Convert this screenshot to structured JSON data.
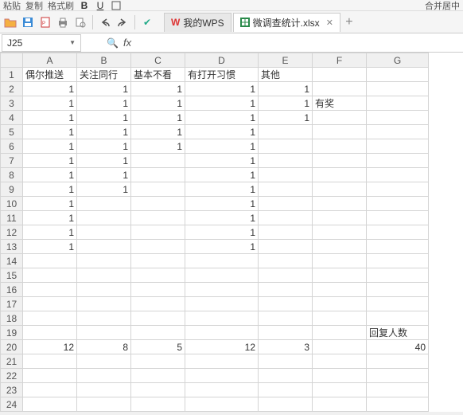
{
  "toolbar": {
    "paste_label": "粘贴",
    "copy_label": "复制",
    "format_painter_label": "格式刷",
    "merge_center_label": "合并居中"
  },
  "tabs": {
    "tab1": {
      "label": "我的WPS"
    },
    "tab2": {
      "label": "微调查统计.xlsx"
    },
    "add_label": "+"
  },
  "formula_bar": {
    "name_box_value": "J25",
    "fx_label": "fx",
    "formula_value": ""
  },
  "columns": [
    "A",
    "B",
    "C",
    "D",
    "E",
    "F",
    "G"
  ],
  "rows": [
    "1",
    "2",
    "3",
    "4",
    "5",
    "6",
    "7",
    "8",
    "9",
    "10",
    "11",
    "12",
    "13",
    "14",
    "15",
    "16",
    "17",
    "18",
    "19",
    "20",
    "21",
    "22",
    "23",
    "24"
  ],
  "headers_row": {
    "A": "偶尔推送",
    "B": "关注同行",
    "C": "基本不看",
    "D": "有打开习惯",
    "E": "其他",
    "F": "",
    "G": ""
  },
  "cells": {
    "r2": {
      "A": "1",
      "B": "1",
      "C": "1",
      "D": "1",
      "E": "1",
      "F": "",
      "G": ""
    },
    "r3": {
      "A": "1",
      "B": "1",
      "C": "1",
      "D": "1",
      "E": "1",
      "F": "有奖",
      "G": ""
    },
    "r4": {
      "A": "1",
      "B": "1",
      "C": "1",
      "D": "1",
      "E": "1",
      "F": "",
      "G": ""
    },
    "r5": {
      "A": "1",
      "B": "1",
      "C": "1",
      "D": "1",
      "E": "",
      "F": "",
      "G": ""
    },
    "r6": {
      "A": "1",
      "B": "1",
      "C": "1",
      "D": "1",
      "E": "",
      "F": "",
      "G": ""
    },
    "r7": {
      "A": "1",
      "B": "1",
      "C": "",
      "D": "1",
      "E": "",
      "F": "",
      "G": ""
    },
    "r8": {
      "A": "1",
      "B": "1",
      "C": "",
      "D": "1",
      "E": "",
      "F": "",
      "G": ""
    },
    "r9": {
      "A": "1",
      "B": "1",
      "C": "",
      "D": "1",
      "E": "",
      "F": "",
      "G": ""
    },
    "r10": {
      "A": "1",
      "B": "",
      "C": "",
      "D": "1",
      "E": "",
      "F": "",
      "G": ""
    },
    "r11": {
      "A": "1",
      "B": "",
      "C": "",
      "D": "1",
      "E": "",
      "F": "",
      "G": ""
    },
    "r12": {
      "A": "1",
      "B": "",
      "C": "",
      "D": "1",
      "E": "",
      "F": "",
      "G": ""
    },
    "r13": {
      "A": "1",
      "B": "",
      "C": "",
      "D": "1",
      "E": "",
      "F": "",
      "G": ""
    },
    "r14": {
      "A": "",
      "B": "",
      "C": "",
      "D": "",
      "E": "",
      "F": "",
      "G": ""
    },
    "r15": {
      "A": "",
      "B": "",
      "C": "",
      "D": "",
      "E": "",
      "F": "",
      "G": ""
    },
    "r16": {
      "A": "",
      "B": "",
      "C": "",
      "D": "",
      "E": "",
      "F": "",
      "G": ""
    },
    "r17": {
      "A": "",
      "B": "",
      "C": "",
      "D": "",
      "E": "",
      "F": "",
      "G": ""
    },
    "r18": {
      "A": "",
      "B": "",
      "C": "",
      "D": "",
      "E": "",
      "F": "",
      "G": ""
    },
    "r19": {
      "A": "",
      "B": "",
      "C": "",
      "D": "",
      "E": "",
      "F": "",
      "G": "回复人数"
    },
    "r20": {
      "A": "12",
      "B": "8",
      "C": "5",
      "D": "12",
      "E": "3",
      "F": "",
      "G": "40"
    },
    "r21": {
      "A": "",
      "B": "",
      "C": "",
      "D": "",
      "E": "",
      "F": "",
      "G": ""
    },
    "r22": {
      "A": "",
      "B": "",
      "C": "",
      "D": "",
      "E": "",
      "F": "",
      "G": ""
    },
    "r23": {
      "A": "",
      "B": "",
      "C": "",
      "D": "",
      "E": "",
      "F": "",
      "G": ""
    },
    "r24": {
      "A": "",
      "B": "",
      "C": "",
      "D": "",
      "E": "",
      "F": "",
      "G": ""
    }
  },
  "icons": {
    "search": "🔍"
  }
}
